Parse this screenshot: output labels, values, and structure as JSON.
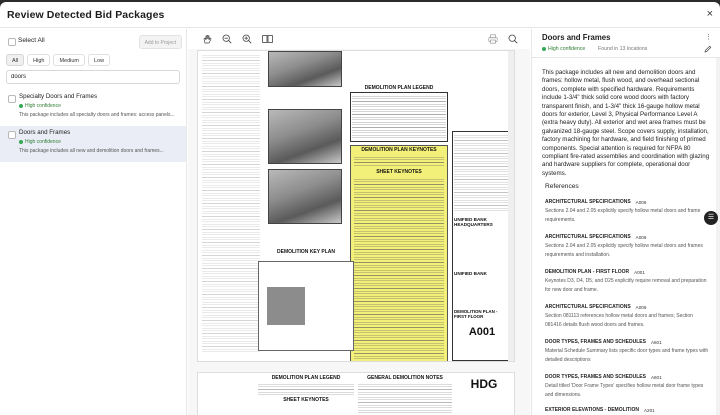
{
  "header": {
    "title": "Review Detected Bid Packages",
    "close": "×"
  },
  "left": {
    "select_all": "Select All",
    "add_button": "Add to Project",
    "filters": [
      "All",
      "High",
      "Medium",
      "Low"
    ],
    "search_value": "doors",
    "packages": [
      {
        "name": "Specialty Doors and Frames",
        "confidence": "High confidence",
        "description": "This package includes all specialty doors and frames: access panels..."
      },
      {
        "name": "Doors and Frames",
        "confidence": "High confidence",
        "description": "This package includes all new and demolition doors and frames..."
      }
    ]
  },
  "viewer": {
    "sheet_title": "DEMOLITION PLAN LEGEND",
    "keynotes_title": "DEMOLITION PLAN KEYNOTES",
    "sheet_keynotes": "SHEET KEYNOTES",
    "key_plan": "DEMOLITION KEY PLAN",
    "firm": "UNIFIED BANK HEADQUARTERS",
    "firm2": "UNIFIED BANK",
    "sheet_name": "DEMOLITION PLAN - FIRST FLOOR",
    "sheet_number": "A001",
    "sheet2_legend": "DEMOLITION PLAN LEGEND",
    "sheet2_notes": "GENERAL DEMOLITION NOTES",
    "sheet2_keynotes": "SHEET KEYNOTES",
    "sheet2_logo": "HDG"
  },
  "right": {
    "title": "Doors and Frames",
    "confidence": "High confidence",
    "found": "Found in 13 locations",
    "body": "This package includes all new and demolition doors and frames: hollow metal, flush wood, and overhead sectional doors, complete with specified hardware. Requirements include 1-3/4\" thick solid core wood doors with factory transparent finish, and 1-3/4\" thick 16-gauge hollow metal doors for exterior, Level 3, Physical Performance Level A (extra heavy duty). All exterior and wet area frames must be galvanized 18-gauge steel. Scope covers supply, installation, factory machining for hardware, and field finishing of primed components. Special attention is required for NFPA 80 compliant fire-rated assemblies and coordination with glazing and hardware suppliers for complete, operational door systems.",
    "references_heading": "References",
    "references": [
      {
        "title": "ARCHITECTURAL SPECIFICATIONS",
        "code": "A006",
        "text": "Sections 2.04 and 2.05 explicitly specify hollow metal doors and frame requirements."
      },
      {
        "title": "ARCHITECTURAL SPECIFICATIONS",
        "code": "A006",
        "text": "Sections 2.04 and 2.05 explicitly specify hollow metal doors and frames requirements and installation."
      },
      {
        "title": "DEMOLITION PLAN - FIRST FLOOR",
        "code": "A001",
        "text": "Keynotes D3, D4, D5, and D25 explicitly require removal and preparation for new door and frame."
      },
      {
        "title": "ARCHITECTURAL SPECIFICATIONS",
        "code": "A006",
        "text": "Section 081113 references hollow metal doors and frames; Section 081416 details flush wood doors and frames."
      },
      {
        "title": "DOOR TYPES, FRAMES AND SCHEDULES",
        "code": "A601",
        "text": "Material Schedule Summary lists specific door types and frame types with detailed descriptions"
      },
      {
        "title": "DOOR TYPES, FRAMES AND SCHEDULES",
        "code": "A601",
        "text": "Detail titled 'Door Frame Types' specifies hollow metal door frame types and dimensions."
      },
      {
        "title": "EXTERIOR ELEVATIONS - DEMOLITION",
        "code": "A201",
        "text": ""
      }
    ]
  }
}
